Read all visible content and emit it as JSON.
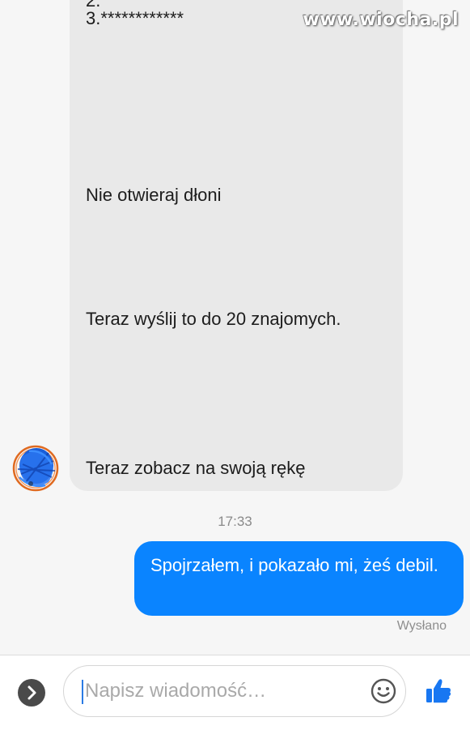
{
  "watermark": "www.wiocha.pl",
  "conversation": {
    "incoming_message": {
      "clipped_top_line": "2.",
      "stars_line": "3.************",
      "lines": [
        "Nie otwieraj dłoni",
        "Teraz wyślij to do 20 znajomych.",
        "Teraz zobacz na swoją rękę"
      ]
    },
    "timestamp": "17:33",
    "outgoing_message": {
      "text": "Spojrzałem, i pokazało mi, żeś debil."
    },
    "status": "Wysłano"
  },
  "composer": {
    "placeholder": "Napisz wiadomość…",
    "icons": {
      "expand": "chevron-right-icon",
      "emoji": "smiley-icon",
      "like": "thumbs-up-icon"
    }
  },
  "colors": {
    "outgoing_bubble": "#0a84ff",
    "incoming_bubble": "#e9e9e9",
    "like_icon": "#1877f2"
  }
}
